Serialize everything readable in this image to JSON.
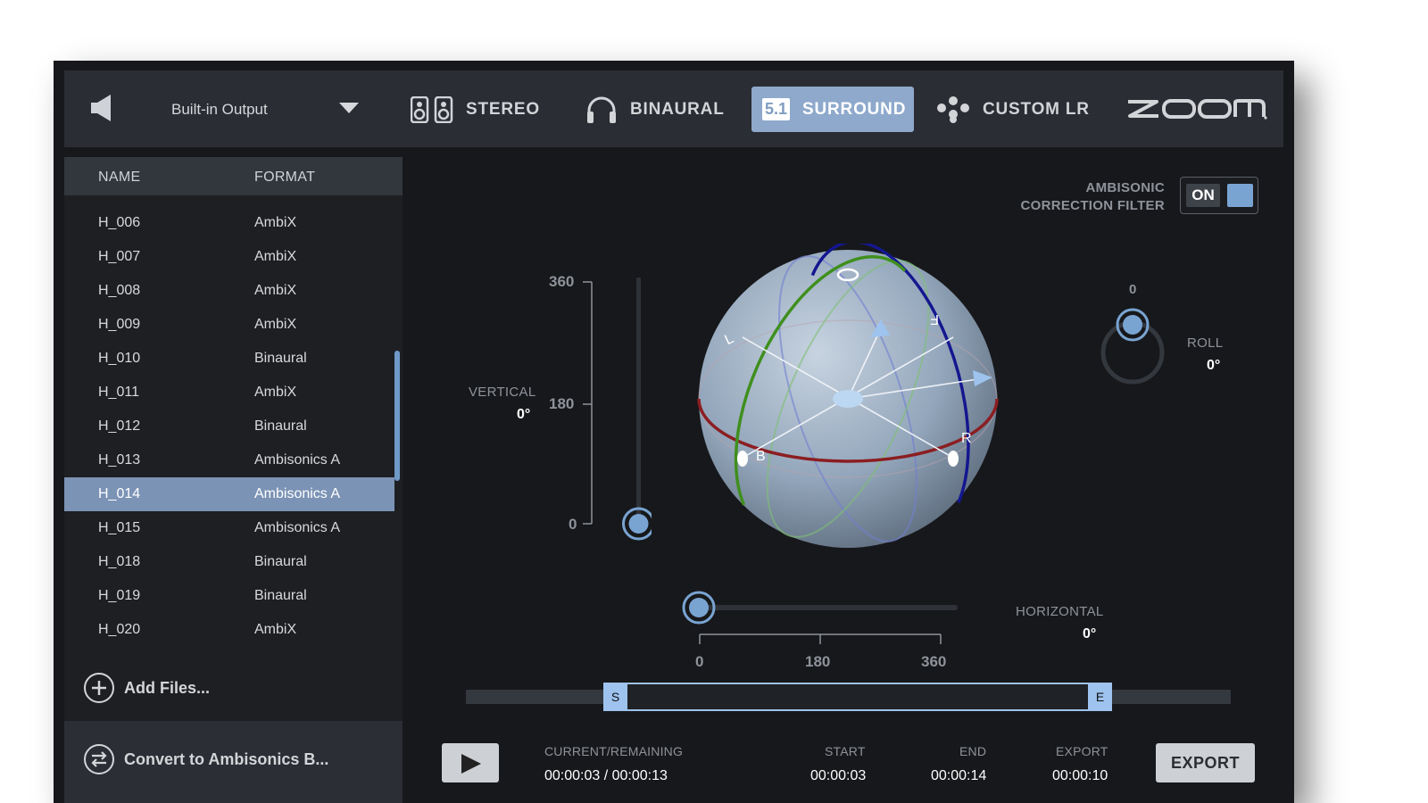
{
  "output": {
    "device": "Built-in Output"
  },
  "modes": [
    {
      "label": "STEREO",
      "icon": "speakers-icon"
    },
    {
      "label": "BINAURAL",
      "icon": "headphones-icon"
    },
    {
      "label": "SURROUND",
      "icon": "5.1",
      "active": true
    },
    {
      "label": "CUSTOM LR",
      "icon": "custom-lr-icon"
    }
  ],
  "brand": {
    "logo": "ZOOM"
  },
  "files": {
    "headers": {
      "name": "NAME",
      "format": "FORMAT"
    },
    "rows": [
      {
        "name": "H_006",
        "format": "AmbiX"
      },
      {
        "name": "H_007",
        "format": "AmbiX"
      },
      {
        "name": "H_008",
        "format": "AmbiX"
      },
      {
        "name": "H_009",
        "format": "AmbiX"
      },
      {
        "name": "H_010",
        "format": "Binaural"
      },
      {
        "name": "H_011",
        "format": "AmbiX"
      },
      {
        "name": "H_012",
        "format": "Binaural"
      },
      {
        "name": "H_013",
        "format": "Ambisonics A"
      },
      {
        "name": "H_014",
        "format": "Ambisonics A",
        "selected": true
      },
      {
        "name": "H_015",
        "format": "Ambisonics A"
      },
      {
        "name": "H_018",
        "format": "Binaural"
      },
      {
        "name": "H_019",
        "format": "Binaural"
      },
      {
        "name": "H_020",
        "format": "AmbiX"
      }
    ],
    "add_label": "Add Files...",
    "convert_label": "Convert to Ambisonics B..."
  },
  "ambisonic": {
    "label_line1": "AMBISONIC",
    "label_line2": "CORRECTION FILTER",
    "state": "ON"
  },
  "vertical": {
    "label": "VERTICAL",
    "value": "0°",
    "ticks": [
      "360",
      "180",
      "0"
    ]
  },
  "horizontal": {
    "label": "HORIZONTAL",
    "value": "0°",
    "ticks": [
      "0",
      "180",
      "360"
    ]
  },
  "roll": {
    "label": "ROLL",
    "value": "0°",
    "tick": "0"
  },
  "sphere_labels": {
    "left": "L",
    "right": "R",
    "back": "B",
    "front": "F"
  },
  "timeline": {
    "start_handle": "S",
    "end_handle": "E"
  },
  "transport": {
    "current_label": "CURRENT/REMAINING",
    "current_value": "00:00:03 / 00:00:13",
    "start_label": "START",
    "start_value": "00:00:03",
    "end_label": "END",
    "end_value": "00:00:14",
    "export_label": "EXPORT",
    "export_value": "00:00:10",
    "export_button": "EXPORT"
  },
  "colors": {
    "accent": "#79a4d2",
    "selection": "#7b93b5",
    "active_mode": "#8ea9cc"
  }
}
